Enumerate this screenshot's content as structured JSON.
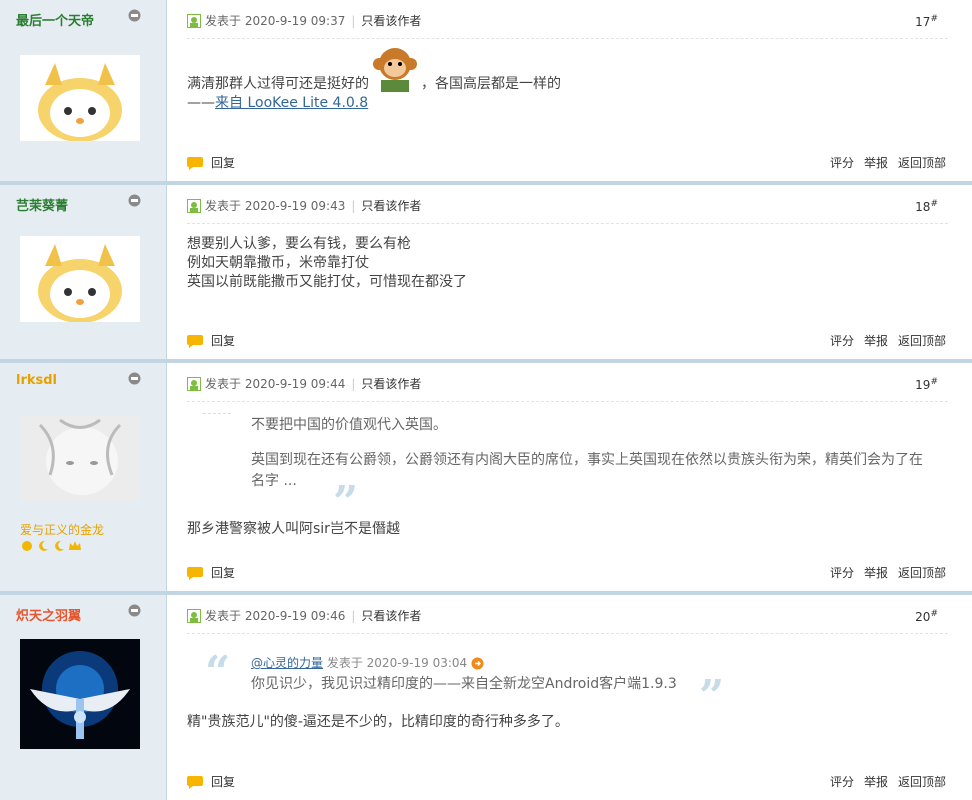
{
  "posts": [
    {
      "username": "最后一个天帝",
      "username_color": "#2b7d31",
      "posted_label": "发表于",
      "time": "2020-9-19 09:37",
      "only_author": "只看该作者",
      "floor": "17",
      "floor_sup": "#",
      "content_line1_a": "满清那群人过得可还是挺好的",
      "content_line1_b": "，各国高层都是一样的",
      "content_line2_prefix": "——",
      "content_link": "来自 LooKee Lite 4.0.8"
    },
    {
      "username": "芑茉葵菁",
      "username_color": "#2b7d31",
      "posted_label": "发表于",
      "time": "2020-9-19 09:43",
      "only_author": "只看该作者",
      "floor": "18",
      "floor_sup": "#",
      "lines": [
        "想要别人认爹，要么有钱，要么有枪",
        "例如天朝靠撒币，米帝靠打仗",
        "英国以前既能撒币又能打仗，可惜现在都没了"
      ]
    },
    {
      "username": "lrksdl",
      "username_color": "#e6a100",
      "posted_label": "发表于",
      "time": "2020-9-19 09:44",
      "only_author": "只看该作者",
      "floor": "19",
      "floor_sup": "#",
      "user_title": "爱与正义的金龙",
      "user_title_color": "#e6a100",
      "quote_line1": "不要把中国的价值观代入英国。",
      "quote_line2": "英国到现在还有公爵领，公爵领还有内阁大臣的席位，事实上英国现在依然以贵族头衔为荣，精英们会为了在",
      "quote_line3": "名字 ...",
      "body": "那乡港警察被人叫阿sir岂不是僭越"
    },
    {
      "username": "炽天之羽翼",
      "username_color": "#e4572e",
      "posted_label": "发表于",
      "time": "2020-9-19 09:46",
      "only_author": "只看该作者",
      "floor": "20",
      "floor_sup": "#",
      "quote_user": "@心灵的力量",
      "quote_posted": "发表于 2020-9-19 03:04",
      "quote_text": "你见识少，我见识过精印度的——来自全新龙空Android客户端1.9.3",
      "body": "精\"贵族范儿\"的傻-逼还是不少的，比精印度的奇行种多多了。"
    }
  ],
  "footer": {
    "reply": "回复",
    "rate": "评分",
    "report": "举报",
    "top": "返回顶部"
  }
}
